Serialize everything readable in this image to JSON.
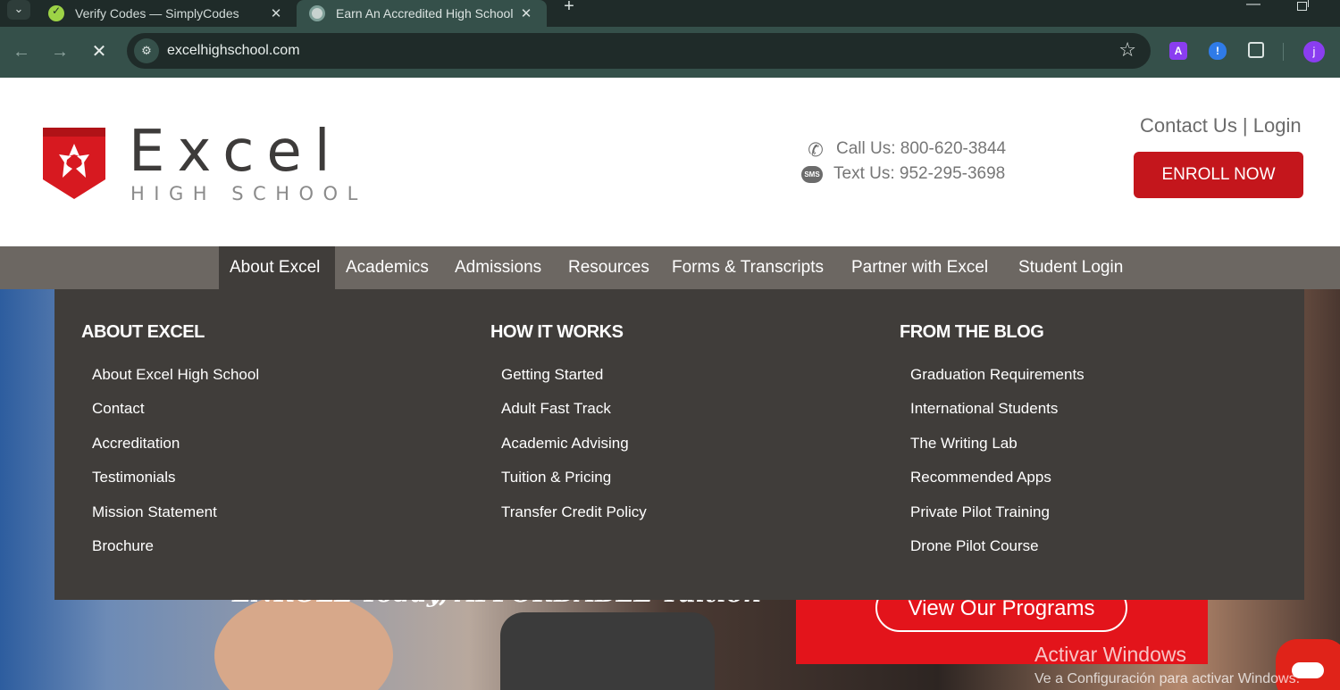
{
  "browser": {
    "tabs": [
      {
        "title": "Verify Codes — SimplyCodes",
        "active": false
      },
      {
        "title": "Earn An Accredited High School",
        "active": true
      }
    ],
    "url": "excelhighschool.com",
    "profile_initial": "j",
    "extension_a": "A",
    "extension_shield": "!"
  },
  "header": {
    "logo_word": "Excel",
    "logo_sub": "HIGH SCHOOL",
    "call": "Call Us: 800-620-3844",
    "text": "Text Us: 952-295-3698",
    "sms_badge": "SMS",
    "contact_login": "Contact Us | Login",
    "enroll": "ENROLL NOW",
    "brand_color": "#c4161c"
  },
  "nav": {
    "items": [
      "About Excel",
      "Academics",
      "Admissions",
      "Resources",
      "Forms & Transcripts",
      "Partner with Excel",
      "Student Login"
    ],
    "active": "About Excel"
  },
  "mega": {
    "columns": [
      {
        "heading": "ABOUT EXCEL",
        "links": [
          "About Excel High School",
          "Contact",
          "Accreditation",
          "Testimonials",
          "Mission Statement",
          "Brochure"
        ]
      },
      {
        "heading": "HOW IT WORKS",
        "links": [
          "Getting Started",
          "Adult Fast Track",
          "Academic Advising",
          "Tuition & Pricing",
          "Transfer Credit Policy"
        ]
      },
      {
        "heading": "FROM THE BLOG",
        "links": [
          "Graduation Requirements",
          "International Students",
          "The Writing Lab",
          "Recommended Apps",
          "Private Pilot Training",
          "Drone Pilot Course"
        ]
      }
    ]
  },
  "hero": {
    "tagline": "ENROLL Today, AFFORDABLE Tuition",
    "programs_button": "View Our Programs"
  },
  "os": {
    "watermark_title": "Activar Windows",
    "watermark_sub": "Ve a Configuración para activar Windows."
  }
}
